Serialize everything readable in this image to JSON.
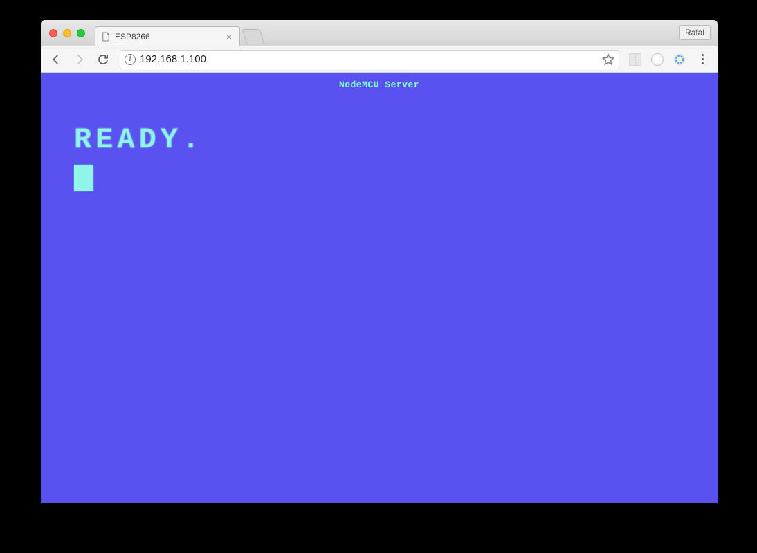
{
  "browser": {
    "tab": {
      "title": "ESP8266"
    },
    "profile_name": "Rafal",
    "url": "192.168.1.100"
  },
  "page": {
    "header": "NodeMCU Server",
    "terminal_line": "READY."
  }
}
